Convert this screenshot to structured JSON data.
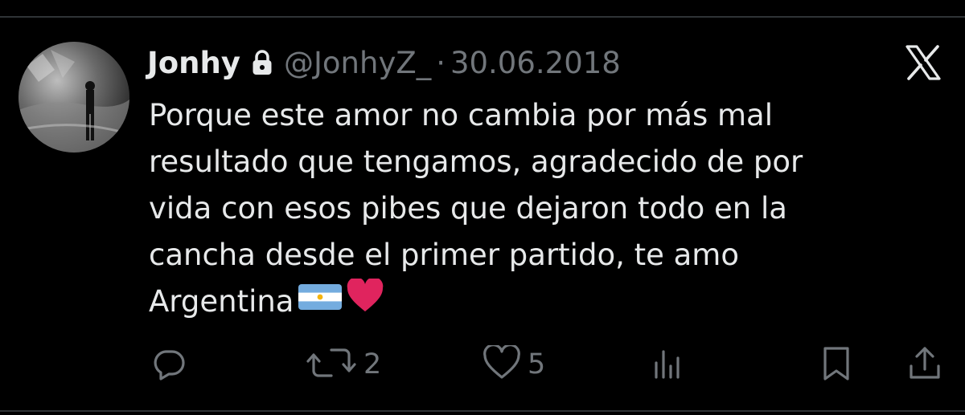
{
  "tweet": {
    "display_name": "Jonhy",
    "handle": "@JonhyZ_",
    "separator": "·",
    "date": "30.06.2018",
    "text": "Porque este amor no cambia por más mal\nresultado que tengamos, agradecido de por\nvida con esos pibes que dejaron todo en la\ncancha desde el primer partido, te amo\nArgentina"
  },
  "icons": {
    "lock": "lock-icon",
    "brand": "x-logo-icon",
    "emojis": [
      "argentina-flag-emoji",
      "red-heart-emoji"
    ]
  },
  "actions": {
    "reply": {
      "icon": "reply-icon",
      "count": ""
    },
    "retweet": {
      "icon": "retweet-icon",
      "count": "2"
    },
    "like": {
      "icon": "heart-icon",
      "count": "5"
    },
    "views": {
      "icon": "views-icon",
      "count": ""
    },
    "bookmark": {
      "icon": "bookmark-icon",
      "count": ""
    },
    "share": {
      "icon": "share-icon",
      "count": ""
    }
  },
  "colors": {
    "background": "#000000",
    "text": "#e7e9ea",
    "muted": "#71767b",
    "heart": "#e0245e"
  }
}
